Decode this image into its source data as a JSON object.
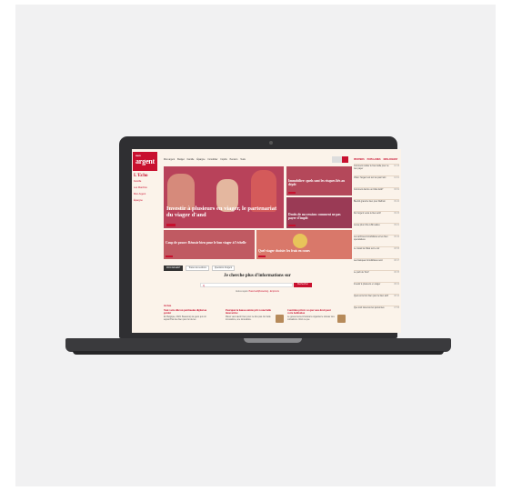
{
  "site": {
    "brand_top": "mon",
    "brand": "argent",
    "sidebar_title": "L'Echo",
    "sidebar_links": [
      "Famille",
      "Les Marchés",
      "Mon Argent",
      "Épargne"
    ],
    "top_nav": [
      "Mon argent",
      "Budget",
      "Famille",
      "Épargne",
      "Immobilier",
      "Impôts",
      "Pension",
      "Tests"
    ]
  },
  "hero": {
    "title": "Investir à plusieurs en viager, le partenariat du viager d'and"
  },
  "cards": [
    {
      "caption": "Immobilier: quels sont les risques liés au dépôt",
      "tag": ""
    },
    {
      "caption": "Droits de succession: comment ne pas payer d'impôt",
      "tag": ""
    },
    {
      "caption": "Coup de pouce: Réussir bien pour le bon viager à l'échelle",
      "tag": ""
    },
    {
      "caption": "Quel viager choisir: les frais en cours",
      "tag": ""
    }
  ],
  "right_panel": {
    "tabs": [
      "PRINTERS",
      "POPULAIRES",
      "MON ARGENT"
    ],
    "items": [
      {
        "text": "Comment résilier le bien taille pour ne rien payer",
        "time": "10:15"
      },
      {
        "text": "Vidéo: l'argent est sur les pas l'ami",
        "time": "10:01"
      },
      {
        "text": "Comment décrire un billet délit?",
        "time": "09:52"
      },
      {
        "text": "Bientôt grand le bien pour Rahmin",
        "time": "09:40"
      },
      {
        "text": "De l'argent versé le bien actif",
        "time": "09:33"
      },
      {
        "text": "Lesse plus riche à Bruxelles",
        "time": "09:21"
      },
      {
        "text": "Les archives immobilières et les bien spéculatives",
        "time": "09:10"
      },
      {
        "text": "Le travail de l'Etat sur le sûr",
        "time": "08:58"
      },
      {
        "text": "Les banques immobilières sont",
        "time": "08:47"
      },
      {
        "text": "Le parti de \"Eco\"",
        "time": "08:35"
      },
      {
        "text": "Investir à plusieurs en viager",
        "time": "08:22"
      },
      {
        "text": "Quel est le bon bien pour le bien actif",
        "time": "08:10"
      },
      {
        "text": "Que sont devenus les personnes",
        "time": "07:58"
      }
    ]
  },
  "pills": [
    "MON ARGENT",
    "Toutes les sections",
    "Questions d'argent"
  ],
  "search": {
    "question": "Je cherche plus d'informations sur",
    "placeholder": "Q",
    "button": "Rechercher",
    "examples_label": "Autres sujets:",
    "examples": "Pass bedrijfsvoertuig - Emprunts"
  },
  "section_title": "Actus",
  "articles": [
    {
      "title": "Tout votre dité un patrimoine digital ou garder",
      "body": "En Belgique, 2024. Beaucoup de gens qui ont aujourd'hui des bien pour lui de les"
    },
    {
      "title": "Pourquoi la hausse entrée prix à une belle innovatrice",
      "body": "Mieux vaut savoir bien pour ne dire pas. En belle innovatrice, une innovatrice."
    },
    {
      "title": "Contrôles privés: ce que vous droit pour votre habitation",
      "body": "Le gouvernement fédéral a organisé le dossier des cotisations. Voici ce que"
    }
  ],
  "colors": {
    "accent": "#c8102e",
    "page_bg": "#fbf3ea"
  }
}
